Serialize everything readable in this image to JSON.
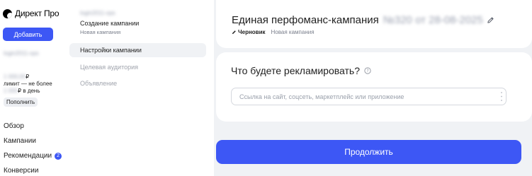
{
  "sidebar": {
    "logo_text": "Директ Про",
    "add_label": "Добавить",
    "account_blurred": "login2011-ops",
    "balance_blurred": "1 000,00",
    "balance_currency": "₽",
    "limit_text": "лимит — не более",
    "limit_blurred": "1 000",
    "limit_suffix": "₽ в день",
    "topup_label": "Пополнить",
    "nav": [
      {
        "label": "Обзор"
      },
      {
        "label": "Кампании"
      },
      {
        "label": "Рекомендации",
        "badge": "2"
      },
      {
        "label": "Конверсии"
      }
    ]
  },
  "mid": {
    "blurred_header": "login2011-ops",
    "title": "Создание кампании",
    "subtitle": "Новая кампания",
    "steps": [
      {
        "label": "Настройки кампании",
        "active": true
      },
      {
        "label": "Целевая аудитория",
        "active": false
      },
      {
        "label": "Объявление",
        "active": false
      }
    ]
  },
  "campaign": {
    "title": "Единая перфоманс-кампания",
    "number_blurred": "№320 от 28-08-2025",
    "status_chip": "Черновик",
    "status_sub": "Новая кампания"
  },
  "question": {
    "title": "Что будете рекламировать?",
    "input_placeholder": "Ссылка на сайт, соцсеть, маркетплейс или приложение",
    "input_value": ""
  },
  "footer": {
    "continue_label": "Продолжить"
  },
  "colors": {
    "accent": "#3d57f5",
    "background": "#f0f2f5"
  },
  "icons": [
    "yandex-direct-logo-icon",
    "pencil-icon",
    "help-circle-icon",
    "resize-grip-icon"
  ]
}
